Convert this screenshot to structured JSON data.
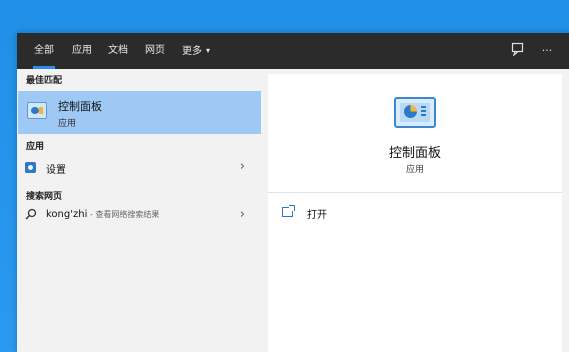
{
  "topbar": {
    "tabs": [
      {
        "label": "全部",
        "active": true
      },
      {
        "label": "应用",
        "active": false
      },
      {
        "label": "文档",
        "active": false
      },
      {
        "label": "网页",
        "active": false
      },
      {
        "label": "更多",
        "active": false
      }
    ],
    "more_caret": "▾",
    "icons": [
      "feedback-icon",
      "more-options-icon"
    ],
    "more_options_glyph": "···"
  },
  "left": {
    "best_match_title": "最佳匹配",
    "best_match": {
      "title": "控制面板",
      "subtitle": "应用",
      "icon": "control-panel-icon"
    },
    "apps_title": "应用",
    "apps": [
      {
        "label": "设置",
        "icon": "gear-icon",
        "chevron": "›"
      }
    ],
    "web_title": "搜索网页",
    "web": [
      {
        "query": "kong'zhi",
        "hint": " - 查看网络搜索结果",
        "icon": "search-icon",
        "chevron": "›"
      }
    ]
  },
  "right": {
    "title": "控制面板",
    "subtitle": "应用",
    "actions": [
      {
        "label": "打开",
        "icon": "open-icon"
      }
    ]
  },
  "colors": {
    "accent": "#2d8cf0",
    "selection": "#9ec9f4",
    "topbar": "#2b2b2b",
    "desktop": "#1f8fe8"
  }
}
